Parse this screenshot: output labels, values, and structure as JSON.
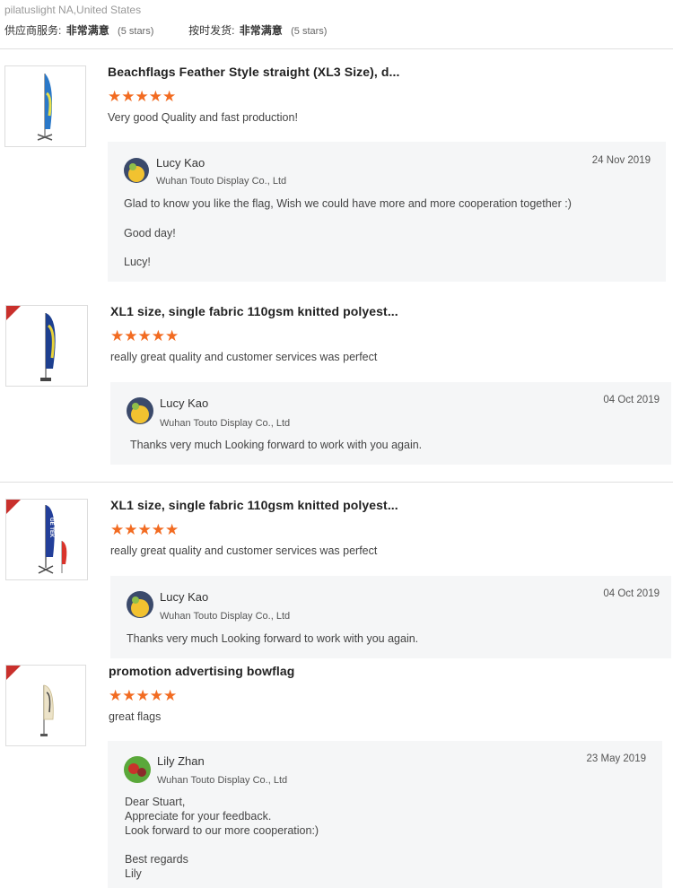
{
  "reviewer": {
    "name_location": "pilatuslight NA,United States"
  },
  "ratings": {
    "supplier_service_label": "供应商服务:",
    "supplier_service_value": "非常满意",
    "supplier_service_stars": "(5 stars)",
    "ontime_label": "按时发货:",
    "ontime_value": "非常满意",
    "ontime_stars": "(5 stars)"
  },
  "reviews": [
    {
      "product_title": "Beachflags Feather Style straight (XL3 Size), d...",
      "stars": "★★★★★",
      "text": "Very good Quality and fast production!",
      "reply": {
        "name": "Lucy Kao",
        "company": "Wuhan Touto Display Co., Ltd",
        "date": "24 Nov 2019",
        "lines": [
          "Glad to know you like the flag, Wish we could have more and more cooperation together :)",
          "Good day!",
          "Lucy!"
        ]
      }
    },
    {
      "product_title": "XL1 size, single fabric 110gsm knitted polyest...",
      "stars": "★★★★★",
      "text": "really great quality and customer services was perfect",
      "reply": {
        "name": "Lucy Kao",
        "company": "Wuhan Touto Display Co., Ltd",
        "date": "04 Oct 2019",
        "lines": [
          "Thanks very much Looking forward to work with you again."
        ]
      }
    },
    {
      "product_title": "XL1 size, single fabric 110gsm knitted polyest...",
      "stars": "★★★★★",
      "text": "really great quality and customer services was perfect",
      "reply": {
        "name": "Lucy Kao",
        "company": "Wuhan Touto Display Co., Ltd",
        "date": "04 Oct 2019",
        "lines": [
          "Thanks very much Looking forward to work with you again."
        ]
      }
    },
    {
      "product_title": "promotion advertising bowflag",
      "stars": "★★★★★",
      "text": "great flags",
      "reply": {
        "name": "Lily Zhan",
        "company": "Wuhan Touto Display Co., Ltd",
        "date": "23 May 2019",
        "lines": [
          "Dear Stuart,",
          "Appreciate for your feedback.",
          "Look forward to our more cooperation:)",
          "Best regards",
          "Lily"
        ]
      }
    }
  ],
  "thumb_labels": {
    "gg_text": "GE TEK"
  },
  "colors": {
    "star": "#f26b21",
    "badge": "#c9302c",
    "reply_bg": "#f5f6f7"
  }
}
